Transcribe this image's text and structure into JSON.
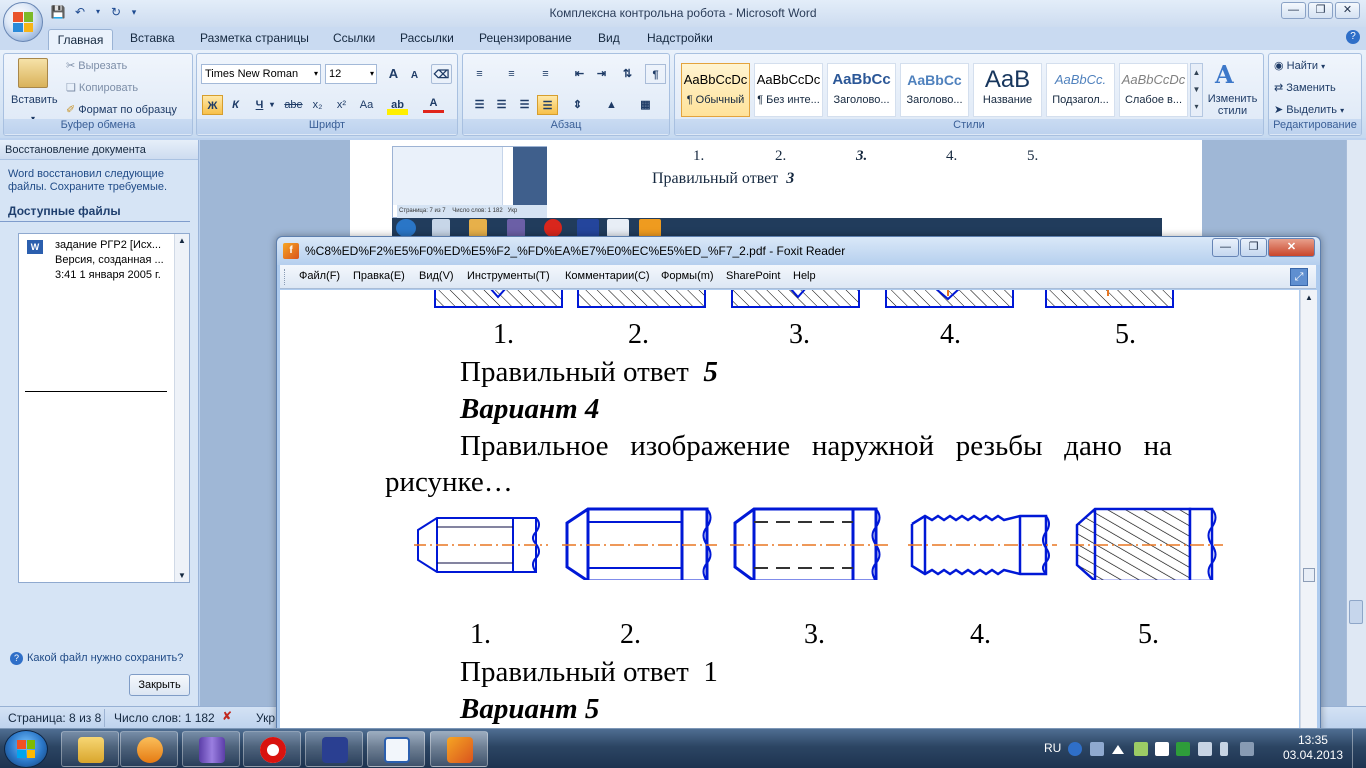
{
  "word": {
    "title": "Комплексна контрольна робота - Microsoft Word",
    "tabs": [
      "Главная",
      "Вставка",
      "Разметка страницы",
      "Ссылки",
      "Рассылки",
      "Рецензирование",
      "Вид",
      "Надстройки"
    ],
    "clipboard": {
      "paste": "Вставить",
      "cut": "Вырезать",
      "copy": "Копировать",
      "format_painter": "Формат по образцу",
      "label": "Буфер обмена"
    },
    "font": {
      "name": "Times New Roman",
      "size": "12",
      "label": "Шрифт",
      "bold": "Ж",
      "italic": "К",
      "underline": "Ч",
      "strike": "abe",
      "sub": "x₂",
      "sup": "x²",
      "case": "Aa",
      "grow": "A",
      "shrink": "A"
    },
    "paragraph": {
      "label": "Абзац"
    },
    "styles": {
      "label": "Стили",
      "items": [
        {
          "sample": "AaBbCcDc",
          "name": "¶ Обычный",
          "selected": true
        },
        {
          "sample": "AaBbCcDc",
          "name": "¶ Без инте..."
        },
        {
          "sample": "AaBbCc",
          "name": "Заголово..."
        },
        {
          "sample": "AaBbCc",
          "name": "Заголово..."
        },
        {
          "sample": "AaB",
          "name": "Название"
        },
        {
          "sample": "AaBbCc.",
          "name": "Подзагол..."
        },
        {
          "sample": "AaBbCcDc",
          "name": "Слабое в..."
        }
      ],
      "change": "Изменить стили"
    },
    "editing": {
      "label": "Редактирование",
      "find": "Найти",
      "replace": "Заменить",
      "select": "Выделить"
    },
    "doc_visible": {
      "nums": [
        "1.",
        "2.",
        "3.",
        "4.",
        "5."
      ],
      "answer": "Правильный ответ",
      "answer_num": "3"
    },
    "status": {
      "page": "Страница: 8 из 8",
      "words": "Число слов: 1 182",
      "lang": "Укр"
    }
  },
  "recovery": {
    "header": "Восстановление документа",
    "message": "Word восстановил следующие файлы.  Сохраните требуемые.",
    "available": "Доступные файлы",
    "file": {
      "name": "задание РГР2  [Исх...",
      "version": "Версия, созданная ...",
      "date": "3:41 1 января 2005 г."
    },
    "ask": "Какой файл нужно сохранить?",
    "close": "Закрыть"
  },
  "foxit": {
    "title": "%C8%ED%F2%E5%F0%ED%E5%F2_%FD%EA%E7%E0%EC%E5%ED_%F7_2.pdf - Foxit Reader",
    "menu": [
      "Файл(F)",
      "Правка(E)",
      "Вид(V)",
      "Инструменты(T)",
      "Комментарии(C)",
      "Формы(m)",
      "SharePoint",
      "Help"
    ],
    "doc": {
      "nums_top": [
        "1.",
        "2.",
        "3.",
        "4.",
        "5."
      ],
      "answer1_label": "Правильный ответ",
      "answer1_num": "5",
      "variant4": "Вариант 4",
      "question_line1": "Правильное   изображение   наружной   резьбы   дано   на",
      "question_line2": "рисунке…",
      "nums_bottom": [
        "1.",
        "2.",
        "3.",
        "4.",
        "5."
      ],
      "answer2_label": "Правильный ответ",
      "answer2_num": "1",
      "variant5": "Вариант 5"
    }
  },
  "taskbar": {
    "lang": "RU",
    "time": "13:35",
    "date": "03.04.2013"
  },
  "colors": {
    "drawing_blue": "#0018d6",
    "center_line": "#e87722"
  }
}
